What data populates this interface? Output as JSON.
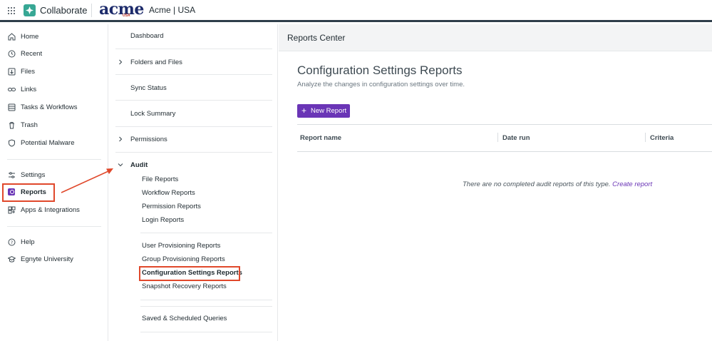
{
  "topbar": {
    "brand_name": "Collaborate",
    "logo_text": "acme",
    "logo_sub": "USA",
    "tenant": "Acme | USA"
  },
  "leftnav": {
    "items": [
      {
        "label": "Home",
        "icon": "home-icon"
      },
      {
        "label": "Recent",
        "icon": "clock-icon"
      },
      {
        "label": "Files",
        "icon": "files-icon"
      },
      {
        "label": "Links",
        "icon": "link-icon"
      },
      {
        "label": "Tasks & Workflows",
        "icon": "tasks-icon"
      },
      {
        "label": "Trash",
        "icon": "trash-icon"
      },
      {
        "label": "Potential Malware",
        "icon": "shield-icon"
      },
      {
        "label": "Settings",
        "icon": "sliders-icon"
      },
      {
        "label": "Reports",
        "icon": "reports-icon"
      },
      {
        "label": "Apps & Integrations",
        "icon": "apps-integrations-icon"
      },
      {
        "label": "Help",
        "icon": "help-icon"
      },
      {
        "label": "Egnyte University",
        "icon": "graduation-cap-icon"
      }
    ]
  },
  "midpanel": {
    "items": [
      {
        "label": "Dashboard"
      },
      {
        "label": "Folders and Files"
      },
      {
        "label": "Sync Status"
      },
      {
        "label": "Lock Summary"
      },
      {
        "label": "Permissions"
      },
      {
        "label": "Audit"
      }
    ],
    "audit_sub": [
      "File Reports",
      "Workflow Reports",
      "Permission Reports",
      "Login Reports",
      "User Provisioning Reports",
      "Group Provisioning Reports",
      "Configuration Settings Reports",
      "Snapshot Recovery Reports",
      "Saved & Scheduled Queries"
    ]
  },
  "main": {
    "header": "Reports Center",
    "title": "Configuration Settings Reports",
    "subtitle": "Analyze the changes in configuration settings over time.",
    "new_button": "New Report",
    "columns": [
      "Report name",
      "Date run",
      "Criteria"
    ],
    "empty_text": "There are no completed audit reports of this type.",
    "empty_link": "Create report"
  },
  "colors": {
    "accent": "#6a35b6",
    "brand_green": "#37a794",
    "callout": "#e0482b",
    "topbar_border": "#2f3e4a"
  }
}
